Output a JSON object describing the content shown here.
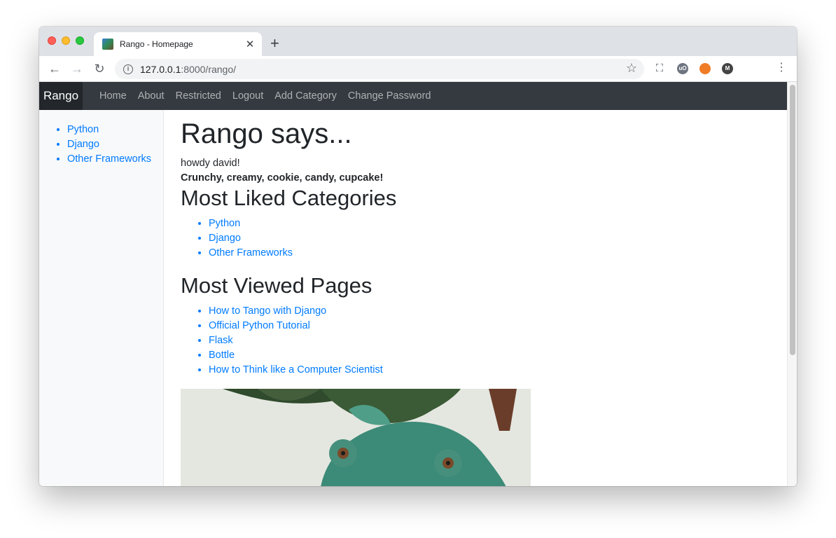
{
  "browser": {
    "tab_title": "Rango - Homepage",
    "url_host": "127.0.0.1",
    "url_rest": ":8000/rango/",
    "extensions": [
      {
        "name": "shield-extension-icon",
        "label": "uO",
        "color": "#6e7480"
      },
      {
        "name": "orange-extension-icon",
        "label": "",
        "color": "#f07c26"
      },
      {
        "name": "m-extension-icon",
        "label": "M",
        "color": "#444444"
      }
    ]
  },
  "navbar": {
    "brand": "Rango",
    "links": [
      "Home",
      "About",
      "Restricted",
      "Logout",
      "Add Category",
      "Change Password"
    ]
  },
  "sidebar": {
    "categories": [
      "Python",
      "Django",
      "Other Frameworks"
    ]
  },
  "main": {
    "heading": "Rango says...",
    "greeting": "howdy david!",
    "slogan": "Crunchy, creamy, cookie, candy, cupcake!",
    "liked_heading": "Most Liked Categories",
    "liked": [
      "Python",
      "Django",
      "Other Frameworks"
    ],
    "viewed_heading": "Most Viewed Pages",
    "viewed": [
      "How to Tango with Django",
      "Official Python Tutorial",
      "Flask",
      "Bottle",
      "How to Think like a Computer Scientist"
    ]
  },
  "colors": {
    "link": "#007bff",
    "navbar": "#343a40"
  }
}
